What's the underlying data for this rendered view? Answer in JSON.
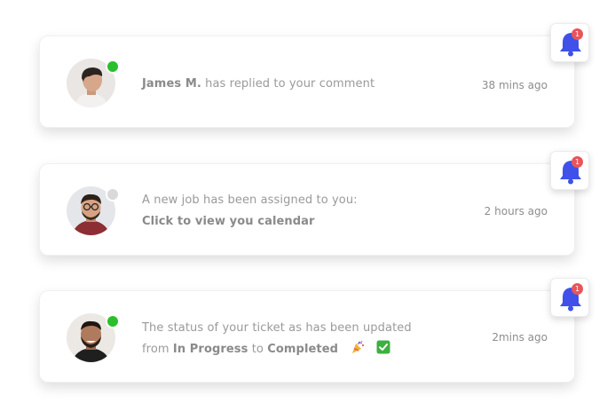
{
  "notifications": [
    {
      "name_bold": "James M.",
      "text": "has replied to your comment",
      "time": "38 mins ago",
      "online_color": "#2bbf2b",
      "badge": "1"
    },
    {
      "line1": "A new job has been assigned to you:",
      "line2_bold": "Click to view you calendar",
      "time": "2 hours ago",
      "online_color": "#d9d9d9",
      "badge": "1"
    },
    {
      "line1": "The status of your ticket as has been updated",
      "from_text": "from",
      "from_bold": "In Progress",
      "to_text": "to",
      "to_bold": "Completed",
      "emoji_1": "party-popper-icon",
      "emoji_2": "check-mark-icon",
      "time": "2mins ago",
      "online_color": "#2bbf2b",
      "badge": "1"
    }
  ],
  "colors": {
    "bell": "#3f51e8",
    "badge": "#e8555a",
    "check": "#3cb043"
  }
}
